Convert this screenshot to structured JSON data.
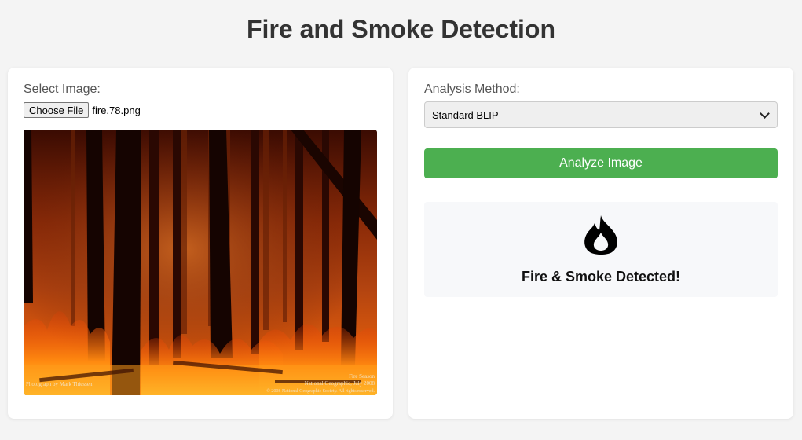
{
  "header": {
    "title": "Fire and Smoke Detection"
  },
  "upload_panel": {
    "label": "Select Image:",
    "choose_button": "Choose File",
    "file_name": "fire.78.png",
    "preview": {
      "caption_left": "Photograph by Mark Thiessen",
      "caption_right_lines": [
        "Fire Season",
        "National Geographic, July 2008",
        "© 2008 National Geographic Society. All rights reserved."
      ]
    }
  },
  "analysis_panel": {
    "label": "Analysis Method:",
    "selected_method": "Standard BLIP",
    "analyze_button": "Analyze Image",
    "result": {
      "icon": "fire-icon",
      "text": "Fire & Smoke Detected!"
    }
  },
  "colors": {
    "background": "#f4f4f4",
    "accent_green": "#4caf50",
    "title": "#333333"
  }
}
